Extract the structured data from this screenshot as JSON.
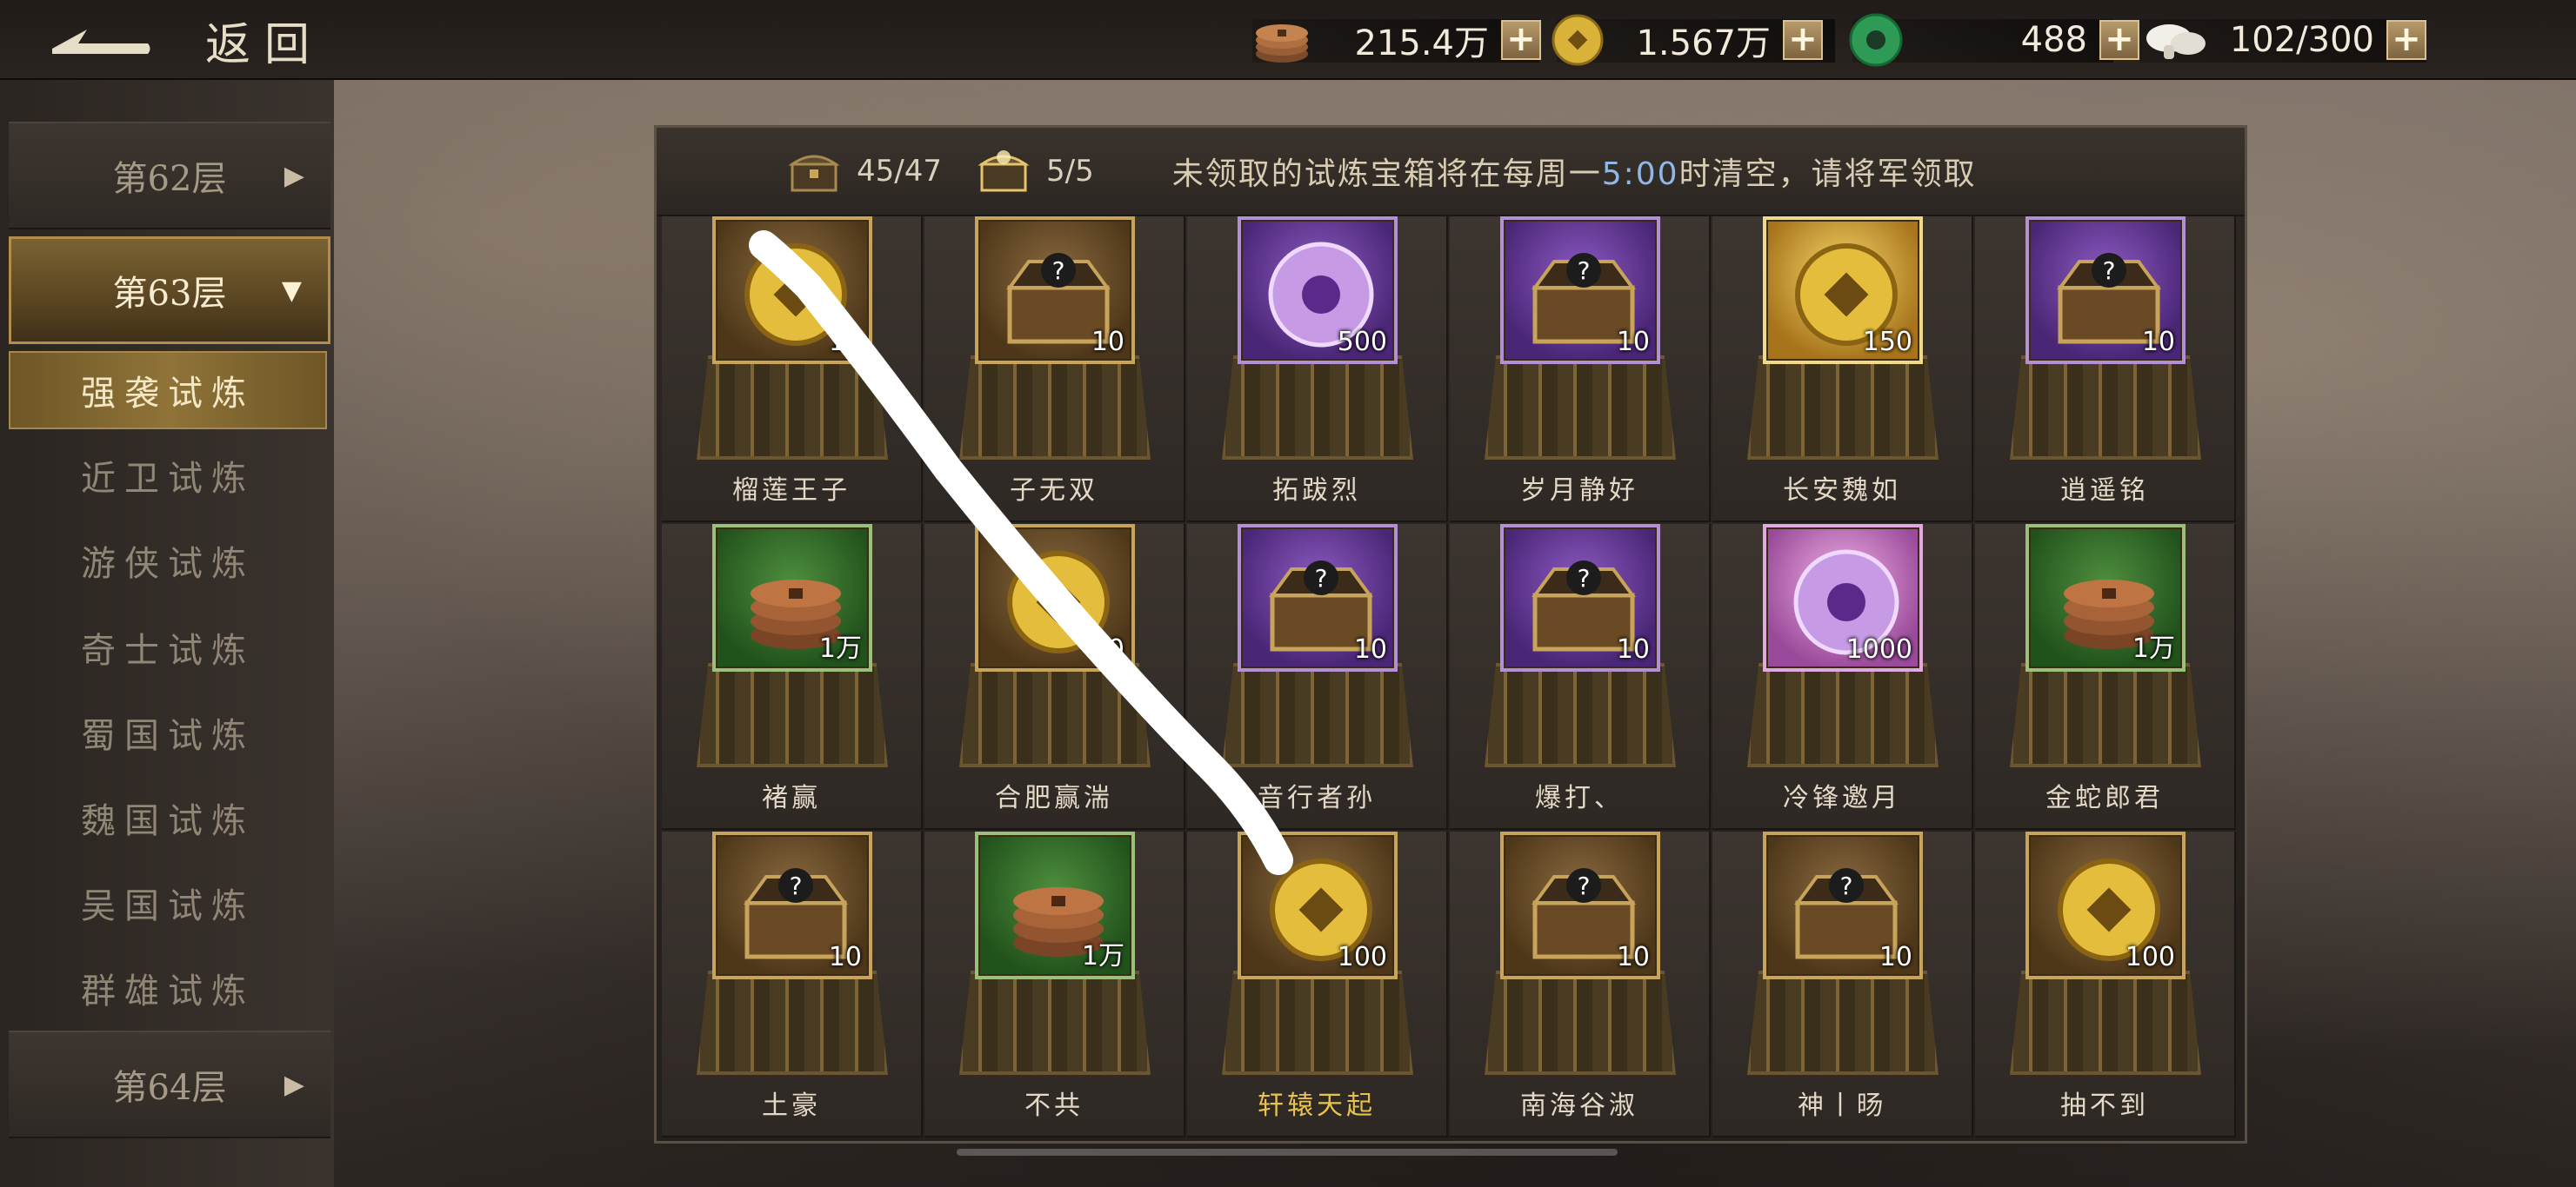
{
  "topbar": {
    "back_label": "返回",
    "resources": [
      {
        "icon": "copper-coins-icon",
        "value": "215.4万"
      },
      {
        "icon": "gold-coin-icon",
        "value": "1.567万"
      },
      {
        "icon": "jade-icon",
        "value": "488"
      },
      {
        "icon": "mushroom-icon",
        "value": "102/300"
      }
    ]
  },
  "sidebar": {
    "floors": [
      {
        "label": "第62层",
        "active": false
      },
      {
        "label": "第63层",
        "active": true
      },
      {
        "label": "第64层",
        "active": false
      }
    ],
    "trials": [
      {
        "label": "强袭试炼",
        "selected": true
      },
      {
        "label": "近卫试炼",
        "selected": false
      },
      {
        "label": "游侠试炼",
        "selected": false
      },
      {
        "label": "奇士试炼",
        "selected": false
      },
      {
        "label": "蜀国试炼",
        "selected": false
      },
      {
        "label": "魏国试炼",
        "selected": false
      },
      {
        "label": "吴国试炼",
        "selected": false
      },
      {
        "label": "群雄试炼",
        "selected": false
      }
    ]
  },
  "panel": {
    "chest_count_normal": "45/47",
    "chest_count_special": "5/5",
    "notice_prefix": "未领取的试炼宝箱将在每周一",
    "notice_time": "5:00",
    "notice_suffix": "时清空，请将军领取",
    "rows": [
      [
        {
          "name": "榴莲王子",
          "qty": "10",
          "frame": "bronze",
          "icon": "gold-coin-icon"
        },
        {
          "name": "子无双",
          "qty": "10",
          "frame": "bronze",
          "icon": "mystery-chest-icon"
        },
        {
          "name": "拓跋烈",
          "qty": "500",
          "frame": "purple",
          "icon": "jade-disc-icon"
        },
        {
          "name": "岁月静好",
          "qty": "10",
          "frame": "purple",
          "icon": "mystery-chest-icon"
        },
        {
          "name": "长安魏如",
          "qty": "150",
          "frame": "gold",
          "icon": "gold-coin-icon"
        },
        {
          "name": "逍遥铭",
          "qty": "10",
          "frame": "purple",
          "icon": "mystery-chest-icon"
        }
      ],
      [
        {
          "name": "褚赢",
          "qty": "1万",
          "frame": "green",
          "icon": "copper-coins-icon"
        },
        {
          "name": "合肥赢湍",
          "qty": "10",
          "frame": "bronze",
          "icon": "gold-coin-icon"
        },
        {
          "name": "音行者孙",
          "qty": "10",
          "frame": "purple",
          "icon": "mystery-chest-icon"
        },
        {
          "name": "爆打、",
          "qty": "10",
          "frame": "purple",
          "icon": "mystery-chest-icon"
        },
        {
          "name": "冷锋邀月",
          "qty": "1000",
          "frame": "pink",
          "icon": "jade-disc-icon"
        },
        {
          "name": "金蛇郎君",
          "qty": "1万",
          "frame": "green",
          "icon": "copper-coins-icon"
        }
      ],
      [
        {
          "name": "土豪",
          "qty": "10",
          "frame": "bronze",
          "icon": "mystery-chest-icon"
        },
        {
          "name": "不共",
          "qty": "1万",
          "frame": "green",
          "icon": "copper-coins-icon"
        },
        {
          "name": "轩辕天起",
          "qty": "100",
          "frame": "bronze",
          "icon": "gold-coin-icon",
          "highlight": true
        },
        {
          "name": "南海谷淑",
          "qty": "10",
          "frame": "bronze",
          "icon": "mystery-chest-icon"
        },
        {
          "name": "神丨旸",
          "qty": "10",
          "frame": "bronze",
          "icon": "mystery-chest-icon"
        },
        {
          "name": "抽不到",
          "qty": "100",
          "frame": "bronze",
          "icon": "gold-coin-icon"
        }
      ]
    ]
  }
}
